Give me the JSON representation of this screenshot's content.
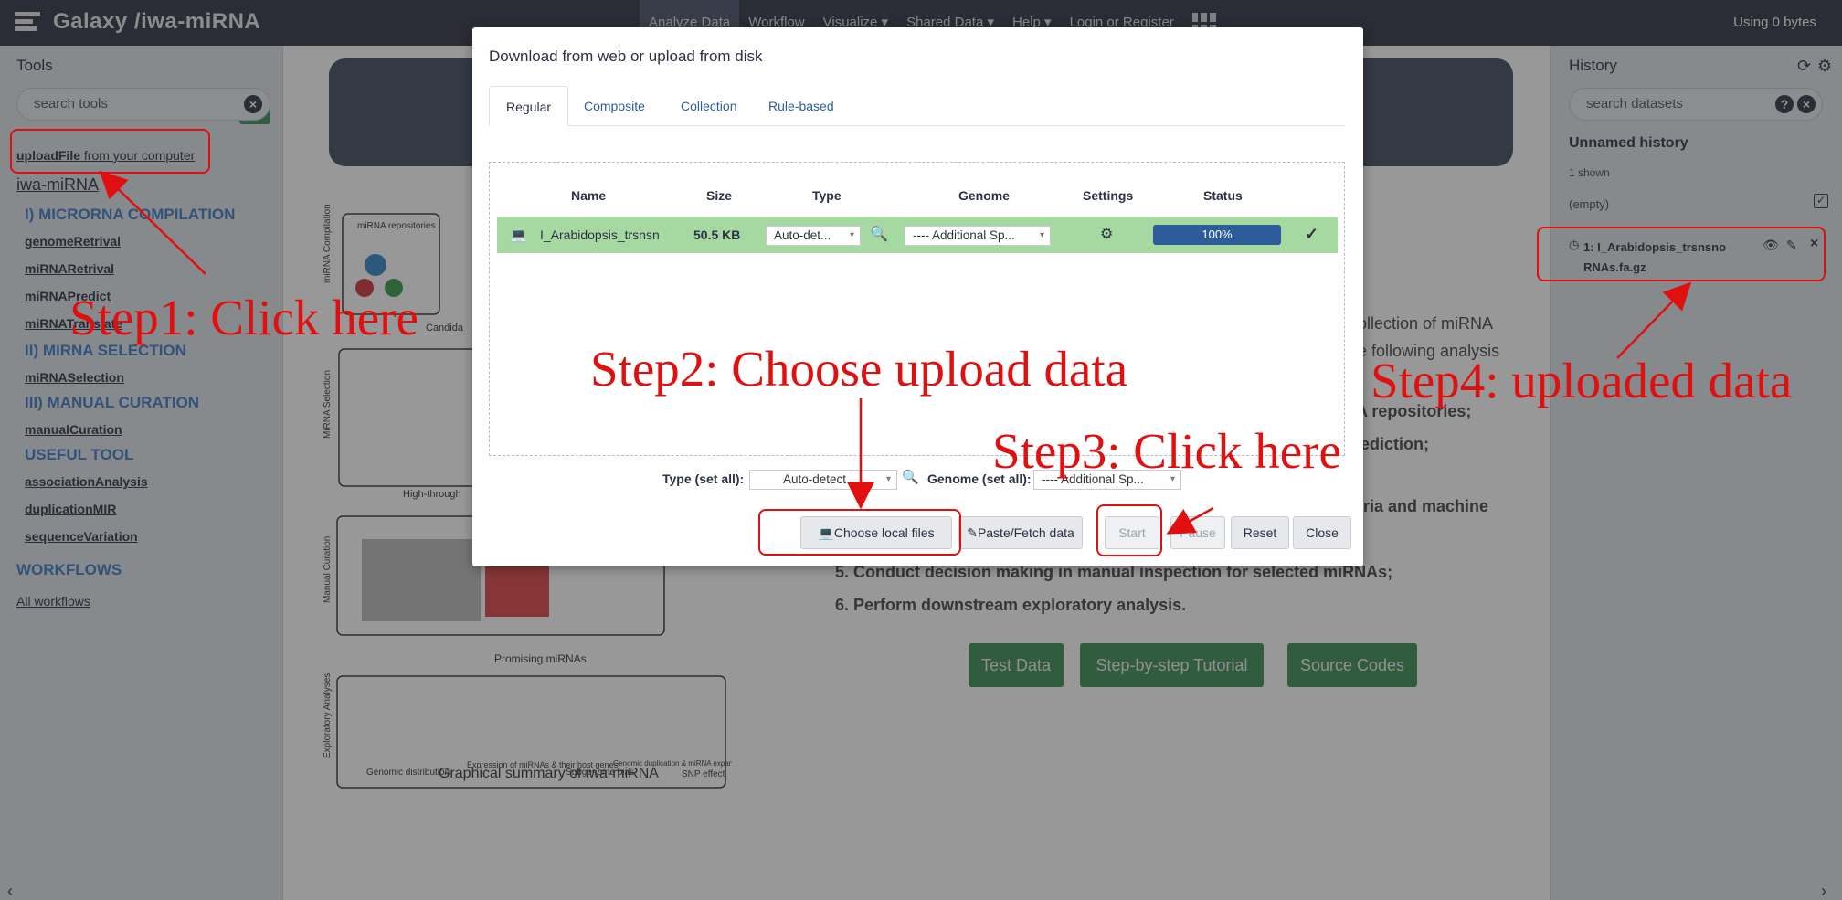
{
  "masthead": {
    "title": "Galaxy /iwa-miRNA",
    "nav": [
      "Analyze Data",
      "Workflow",
      "Visualize ▾",
      "Shared Data ▾",
      "Help ▾",
      "Login or Register"
    ],
    "usage": "Using 0 bytes"
  },
  "tools": {
    "title": "Tools",
    "search_placeholder": "search tools",
    "upload_link_bold": "uploadFile",
    "upload_link_rest": " from your computer",
    "group": "iwa-miRNA",
    "sections": [
      {
        "label": "I) MICRORNA COMPILATION",
        "items": [
          "genomeRetrival",
          "miRNARetrival",
          "miRNAPredict",
          "miRNATranslate"
        ]
      },
      {
        "label": "II) MIRNA SELECTION",
        "items": [
          "miRNASelection"
        ]
      },
      {
        "label": "III) MANUAL CURATION",
        "items": [
          "manualCuration"
        ]
      },
      {
        "label": "USEFUL TOOL",
        "items": [
          "associationAnalysis",
          "duplicationMIR",
          "sequenceVariation"
        ]
      }
    ],
    "workflows_label": "WORKFLOWS",
    "all_workflows": "All workflows"
  },
  "center": {
    "caption": "Graphical summary of iwa-miRNA",
    "fig_labels": [
      "miRNA Compilation",
      "MiRNA Selection",
      "Manual Curation",
      "Exploratory Analyses"
    ],
    "fig_texts": [
      "miRNA repositories",
      "Candida",
      "High-through",
      "Promising miRNAs",
      "Genomic distribution",
      "Expression of miRNAs & their host genes",
      "Subgenome bias",
      "Genomic duplication & miRNA expansion",
      "SNP effect"
    ],
    "intro_lines": [
      "ollection of miRNA",
      "e following analysis"
    ],
    "bold_lines": [
      "NA repositories;",
      "prediction;",
      "iteria and machine",
      "5. Conduct decision making in manual inspection for selected miRNAs;",
      "6. Perform downstream exploratory analysis."
    ],
    "buttons": [
      "Test Data",
      "Step-by-step Tutorial",
      "Source Codes"
    ]
  },
  "history": {
    "title": "History",
    "search_placeholder": "search datasets",
    "name": "Unnamed history",
    "shown": "1 shown",
    "empty": "(empty)",
    "item": "1: I_Arabidopsis_trsnsno RNAs.fa.gz"
  },
  "modal": {
    "title": "Download from web or upload from disk",
    "tabs": [
      "Regular",
      "Composite",
      "Collection",
      "Rule-based"
    ],
    "headers": [
      "Name",
      "Size",
      "Type",
      "Genome",
      "Settings",
      "Status"
    ],
    "row": {
      "name": "I_Arabidopsis_trsnsn",
      "size": "50.5 KB",
      "type": "Auto-det...",
      "genome": "---- Additional Sp...",
      "progress": "100%"
    },
    "type_set_all_label": "Type (set all):",
    "type_set_all_value": "Auto-detect",
    "genome_set_all_label": "Genome (set all):",
    "genome_set_all_value": "---- Additional Sp...",
    "buttons": [
      "Choose local files",
      "Paste/Fetch data",
      "Start",
      "Pause",
      "Reset",
      "Close"
    ]
  },
  "annotations": {
    "step1": "Step1: Click here",
    "step2": "Step2: Choose upload data",
    "step3": "Step3: Click here",
    "step4": "Step4: uploaded data",
    "color": "#e01010"
  }
}
